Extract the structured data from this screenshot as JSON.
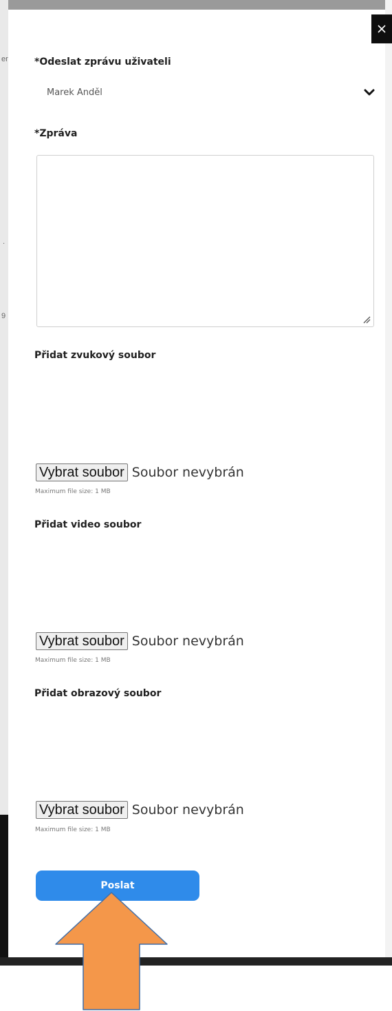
{
  "dialog": {
    "recipient_label": "*Odeslat zprávu uživateli",
    "recipient_value": "Marek Anděl",
    "message_label": "*Zpráva",
    "message_value": "",
    "send_label": "Poslat",
    "accent_color": "#2f8bea"
  },
  "attachments": [
    {
      "label": "Přidat zvukový soubor",
      "button": "Vybrat soubor",
      "status": "Soubor nevybrán",
      "hint": "Maximum file size: 1 MB"
    },
    {
      "label": "Přidat video soubor",
      "button": "Vybrat soubor",
      "status": "Soubor nevybrán",
      "hint": "Maximum file size: 1 MB"
    },
    {
      "label": "Přidat obrazový soubor",
      "button": "Vybrat soubor",
      "status": "Soubor nevybrán",
      "hint": "Maximum file size: 1 MB"
    }
  ],
  "background": {
    "glyphs": [
      "er",
      ".",
      "9"
    ]
  },
  "icons": {
    "close": "close-icon",
    "dropdown": "chevron-down-icon",
    "resize": "resize-grip-icon",
    "annotation": "arrow-up-annotation",
    "annotation_color": "#f4974a"
  }
}
